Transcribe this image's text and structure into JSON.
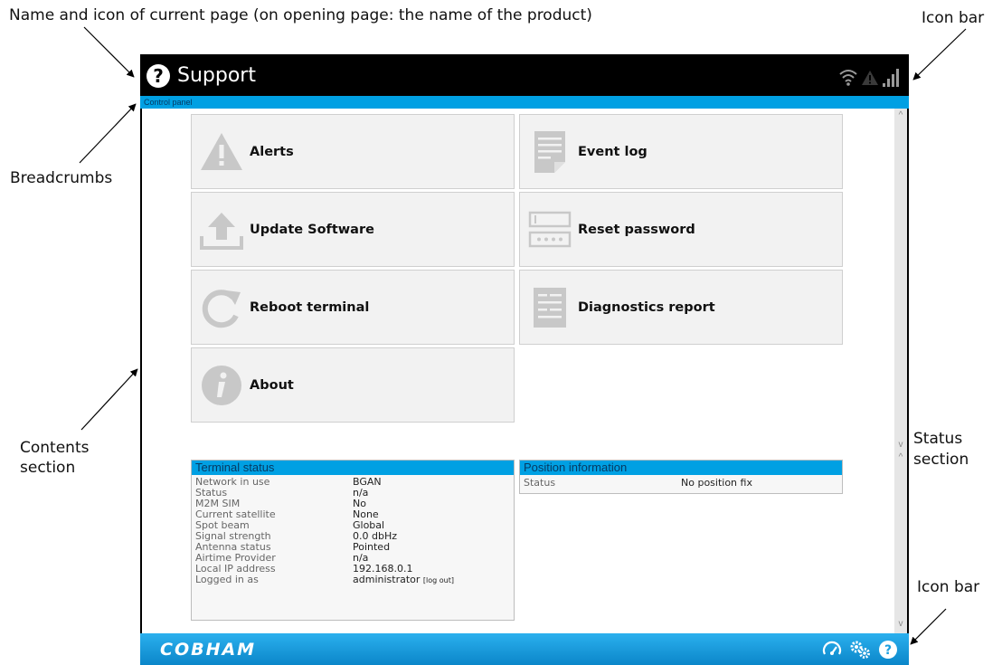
{
  "annotations": {
    "name_icon": "Name and icon of current page (on opening page: the name of the product)",
    "icon_bar_top": "Icon bar",
    "breadcrumbs": "Breadcrumbs",
    "contents_line1": "Contents",
    "contents_line2": "section",
    "status_line1": "Status",
    "status_line2": "section",
    "icon_bar_bottom": "Icon bar"
  },
  "header": {
    "title": "Support",
    "icon": "question-circle-icon"
  },
  "top_icons": [
    "wifi-icon",
    "warning-icon",
    "signal-bars-icon"
  ],
  "breadcrumb": "Control panel",
  "tiles": [
    {
      "label": "Alerts",
      "icon": "alert-triangle-icon"
    },
    {
      "label": "Event log",
      "icon": "document-icon"
    },
    {
      "label": "Update Software",
      "icon": "upload-icon"
    },
    {
      "label": "Reset password",
      "icon": "password-field-icon"
    },
    {
      "label": "Reboot terminal",
      "icon": "reboot-icon"
    },
    {
      "label": "Diagnostics report",
      "icon": "report-icon"
    },
    {
      "label": "About",
      "icon": "info-icon"
    }
  ],
  "terminal_status": {
    "title": "Terminal status",
    "rows": [
      {
        "key": "Network in use",
        "value": "BGAN"
      },
      {
        "key": "Status",
        "value": "n/a"
      },
      {
        "key": "M2M SIM",
        "value": "No"
      },
      {
        "key": "Current satellite",
        "value": "None"
      },
      {
        "key": "Spot beam",
        "value": "Global"
      },
      {
        "key": "Signal strength",
        "value": "0.0 dbHz"
      },
      {
        "key": "Antenna status",
        "value": "Pointed"
      },
      {
        "key": "Airtime Provider",
        "value": "n/a"
      },
      {
        "key": "Local IP address",
        "value": "192.168.0.1"
      },
      {
        "key": "Logged in as",
        "value": "administrator"
      }
    ],
    "logout_label": "[log out]"
  },
  "position_info": {
    "title": "Position information",
    "rows": [
      {
        "key": "Status",
        "value": "No position fix"
      }
    ]
  },
  "footer": {
    "logo": "COBHAM",
    "icons": [
      "dashboard-gauge-icon",
      "settings-gears-icon",
      "help-icon"
    ]
  },
  "colors": {
    "accent": "#00a0e3",
    "footer": "#1a9fe0",
    "tile": "#f2f2f2",
    "icon_grey": "#c8c8c8"
  }
}
